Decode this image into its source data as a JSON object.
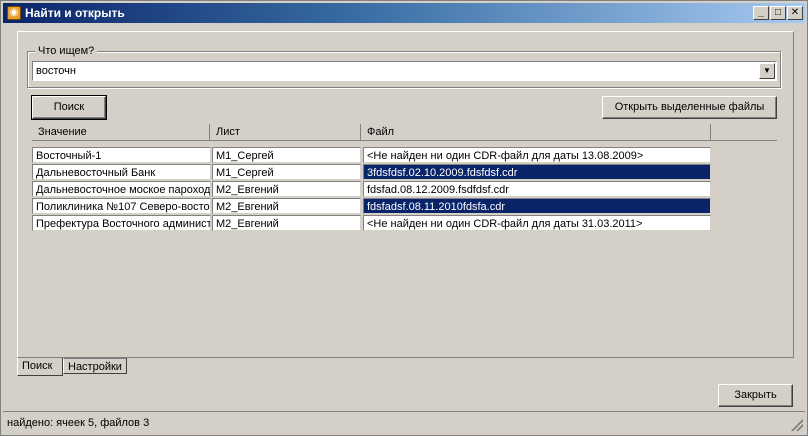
{
  "window": {
    "title": "Найти и открыть",
    "minimize": "_",
    "maximize": "□",
    "close": "✕"
  },
  "search": {
    "legend": "Что ищем?",
    "value": "восточн",
    "dropdown_glyph": "▼"
  },
  "buttons": {
    "search": "Поиск",
    "open_selected": "Открыть выделенные файлы",
    "close": "Закрыть"
  },
  "table": {
    "columns": [
      "Значение",
      "Лист",
      "Файл"
    ],
    "rows": [
      {
        "value": "Восточный-1",
        "sheet": "М1_Сергей",
        "file": "<Не найден ни один CDR-файл для даты 13.08.2009>",
        "selected": false
      },
      {
        "value": "Дальневосточный Банк",
        "sheet": "М1_Сергей",
        "file": "3fdsfdsf.02.10.2009.fdsfdsf.cdr",
        "selected": true
      },
      {
        "value": "Дальневосточное моское пароход",
        "sheet": "М2_Евгений",
        "file": "fdsfad.08.12.2009.fsdfdsf.cdr",
        "selected": false
      },
      {
        "value": "Поликлиника №107 Северо-восто",
        "sheet": "М2_Евгений",
        "file": "fdsfadsf.08.11.2010fdsfa.cdr",
        "selected": true
      },
      {
        "value": "Префектура Восточного админист",
        "sheet": "М2_Евгений",
        "file": "<Не найден ни один CDR-файл для даты 31.03.2011>",
        "selected": false
      }
    ]
  },
  "tabs": [
    {
      "label": "Поиск",
      "active": true
    },
    {
      "label": "Настройки",
      "active": false
    }
  ],
  "status": {
    "text": "найдено: ячеек 5, файлов 3"
  }
}
